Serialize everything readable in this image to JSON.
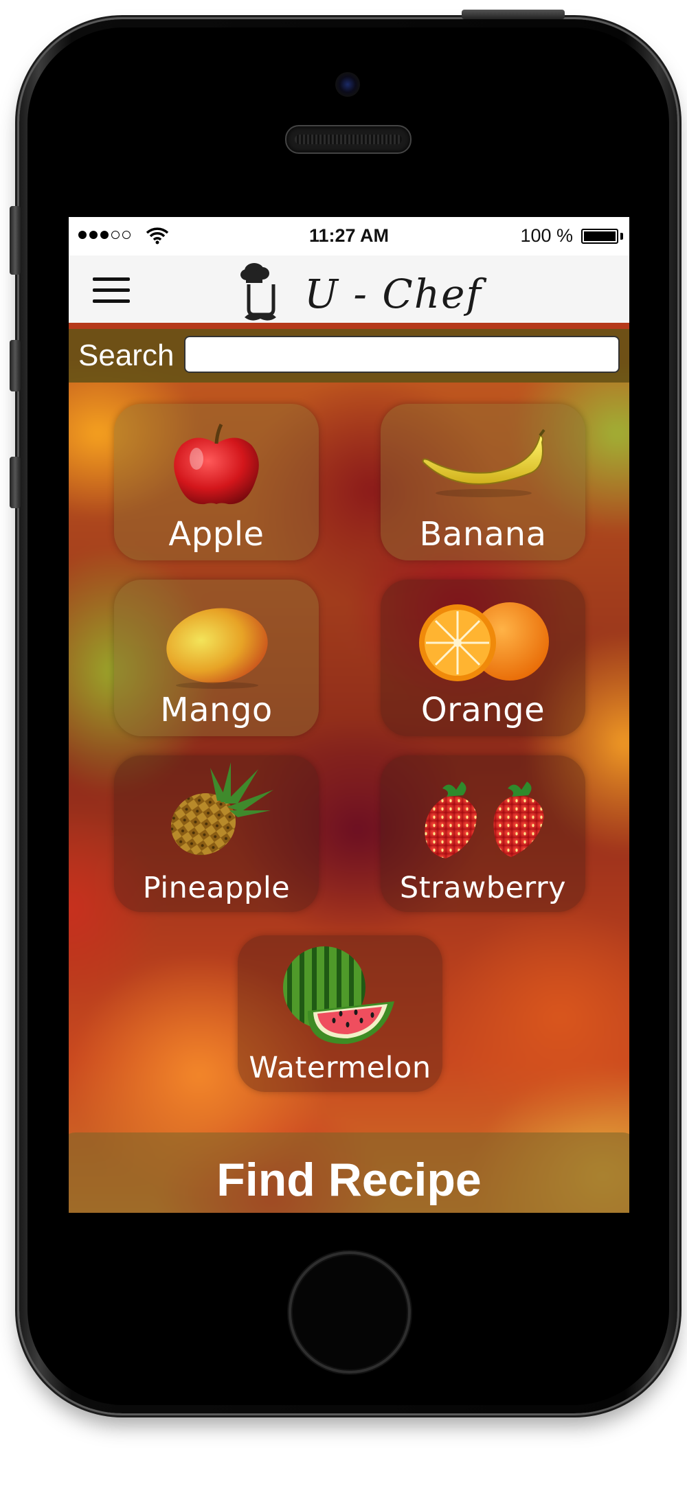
{
  "status_bar": {
    "time": "11:27 AM",
    "battery": "100 %",
    "battery_level": 1.0,
    "signal_bars": 3,
    "signal_max": 5
  },
  "header": {
    "app_title": "U - Chef",
    "menu_icon": "hamburger-menu-icon",
    "logo_icon": "chef-hat-mustache-icon"
  },
  "search": {
    "label": "Search",
    "value": "",
    "placeholder": ""
  },
  "fruits": [
    {
      "label": "Apple",
      "icon": "apple-icon"
    },
    {
      "label": "Banana",
      "icon": "banana-icon"
    },
    {
      "label": "Mango",
      "icon": "mango-icon"
    },
    {
      "label": "Orange",
      "icon": "orange-icon"
    },
    {
      "label": "Pineapple",
      "icon": "pineapple-icon"
    },
    {
      "label": "Strawberry",
      "icon": "strawberry-icon"
    },
    {
      "label": "Watermelon",
      "icon": "watermelon-icon"
    }
  ],
  "action": {
    "find_recipe_label": "Find Recipe"
  },
  "colors": {
    "search_bar": "#685216",
    "tile_overlay": "#46201480",
    "status_bar_bg": "#ffffff",
    "nav_bar_bg": "#f5f5f5"
  }
}
